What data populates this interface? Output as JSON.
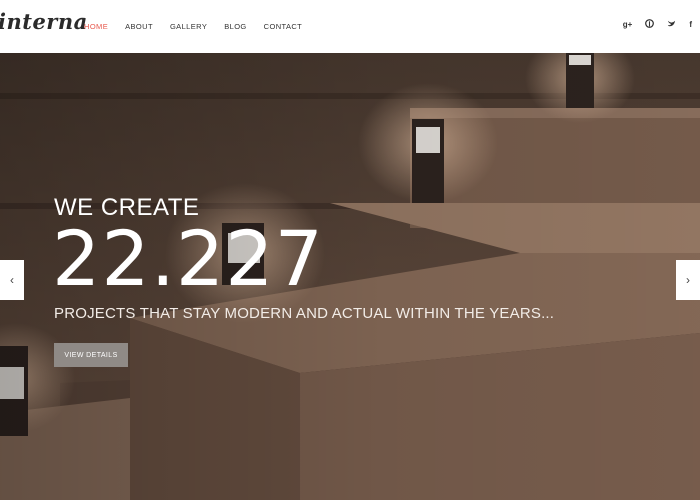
{
  "header": {
    "logo": "interna",
    "nav": [
      {
        "label": "HOME",
        "active": true
      },
      {
        "label": "ABOUT",
        "active": false
      },
      {
        "label": "GALLERY",
        "active": false
      },
      {
        "label": "BLOG",
        "active": false
      },
      {
        "label": "CONTACT",
        "active": false
      }
    ],
    "social": [
      "g+",
      "pinterest-icon",
      "twitter-icon",
      "f"
    ]
  },
  "hero": {
    "subtitle": "WE CREATE",
    "number": "22.227",
    "description": "PROJECTS THAT STAY MODERN AND ACTUAL WITHIN THE YEARS...",
    "button_label": "VIEW DETAILS",
    "prev_arrow": "‹",
    "next_arrow": "›"
  },
  "colors": {
    "accent": "#e8584d",
    "button": "#8f8a86"
  }
}
